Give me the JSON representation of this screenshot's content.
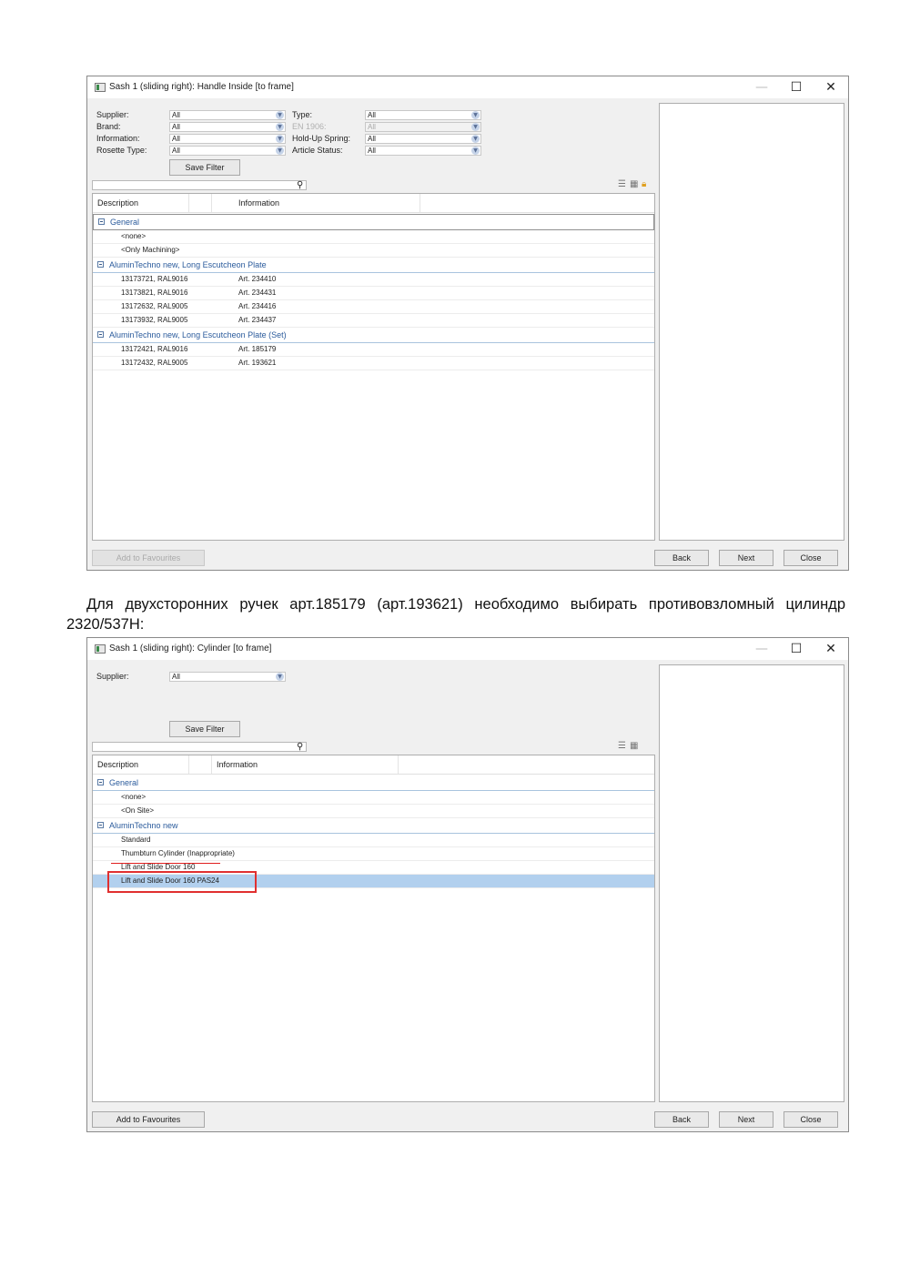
{
  "window1": {
    "title": "Sash 1 (sliding right): Handle Inside [to frame]",
    "filters": [
      {
        "label": "Supplier:",
        "value": "All"
      },
      {
        "label": "Brand:",
        "value": "All"
      },
      {
        "label": "Information:",
        "value": "All"
      },
      {
        "label": "Rosette Type:",
        "value": "All"
      },
      {
        "label": "Type:",
        "value": "All"
      },
      {
        "label": "EN 1906:",
        "value": "All"
      },
      {
        "label": "Hold-Up Spring:",
        "value": "All"
      },
      {
        "label": "Article Status:",
        "value": "All"
      }
    ],
    "save_filter": "Save Filter",
    "columns": [
      "Description",
      "Information"
    ],
    "groups": [
      {
        "title": "General",
        "items": [
          {
            "desc": "<none>",
            "info": ""
          },
          {
            "desc": "<Only Machining>",
            "info": ""
          }
        ]
      },
      {
        "title": "AluminTechno new, Long Escutcheon Plate",
        "items": [
          {
            "desc": "13173721, RAL9016",
            "info": "Art. 234410"
          },
          {
            "desc": "13173821, RAL9016",
            "info": "Art. 234431"
          },
          {
            "desc": "13172632, RAL9005",
            "info": "Art. 234416"
          },
          {
            "desc": "13173932, RAL9005",
            "info": "Art. 234437"
          }
        ]
      },
      {
        "title": "AluminTechno new, Long Escutcheon Plate (Set)",
        "items": [
          {
            "desc": "13172421, RAL9016",
            "info": "Art. 185179"
          },
          {
            "desc": "13172432, RAL9005",
            "info": "Art. 193621"
          }
        ]
      }
    ],
    "buttons": {
      "favourites": "Add to Favourites",
      "back": "Back",
      "next": "Next",
      "close": "Close"
    }
  },
  "caption": "Для двухсторонних ручек арт.185179 (арт.193621) необходимо выбирать противовзломный цилиндр 2320/537H:",
  "window2": {
    "title": "Sash 1 (sliding right): Cylinder [to frame]",
    "filters": [
      {
        "label": "Supplier:",
        "value": "All"
      }
    ],
    "save_filter": "Save Filter",
    "columns": [
      "Description",
      "Information"
    ],
    "groups": [
      {
        "title": "General",
        "items": [
          {
            "desc": "<none>",
            "info": ""
          },
          {
            "desc": "<On Site>",
            "info": ""
          }
        ]
      },
      {
        "title": "AluminTechno new",
        "items": [
          {
            "desc": "Standard",
            "info": ""
          },
          {
            "desc": "Thumbturn Cylinder (Inappropriate)",
            "info": ""
          },
          {
            "desc": "Lift and Slide Door 160",
            "info": ""
          },
          {
            "desc": "Lift and Slide Door 160 PAS24",
            "info": ""
          }
        ]
      }
    ],
    "buttons": {
      "favourites": "Add to Favourites",
      "back": "Back",
      "next": "Next",
      "close": "Close"
    }
  },
  "icons": {
    "search": "search-icon",
    "list_view": "list-view-icon",
    "grid_view": "grid-view-icon",
    "lock": "lock-icon"
  },
  "colors": {
    "group_title": "#2b5b9c",
    "selected_row": "#b2d0ee",
    "annotation": "#e03030"
  }
}
